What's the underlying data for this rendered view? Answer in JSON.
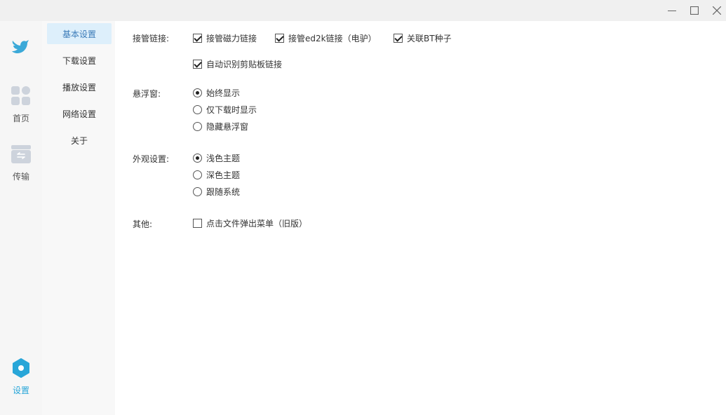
{
  "window": {
    "minimize_icon": "minimize-icon",
    "maximize_icon": "maximize-icon",
    "close_icon": "close-icon"
  },
  "rail": {
    "logo_icon": "bird-logo-icon",
    "items": [
      {
        "label": "首页",
        "icon": "grid-icon"
      },
      {
        "label": "传输",
        "icon": "transfer-icon"
      },
      {
        "label": "设置",
        "icon": "settings-icon",
        "active": true
      }
    ],
    "accent": "#28a6d8"
  },
  "submenu": {
    "items": [
      "基本设置",
      "下载设置",
      "播放设置",
      "网络设置",
      "关于"
    ],
    "active_index": 0,
    "active_bg": "#ddeffb"
  },
  "settings": {
    "link_takeover": {
      "label": "接管链接:",
      "options": [
        {
          "label": "接管磁力链接",
          "checked": true
        },
        {
          "label": "接管ed2k链接（电驴）",
          "checked": true
        },
        {
          "label": "关联BT种子",
          "checked": true
        },
        {
          "label": "自动识别剪贴板链接",
          "checked": true
        }
      ]
    },
    "floating_window": {
      "label": "悬浮窗:",
      "options": [
        "始终显示",
        "仅下载时显示",
        "隐藏悬浮窗"
      ],
      "selected": "始终显示"
    },
    "appearance": {
      "label": "外观设置:",
      "options": [
        "浅色主题",
        "深色主题",
        "跟随系统"
      ],
      "selected": "浅色主题"
    },
    "other": {
      "label": "其他:",
      "options": [
        {
          "label": "点击文件弹出菜单（旧版）",
          "checked": false
        }
      ]
    }
  }
}
